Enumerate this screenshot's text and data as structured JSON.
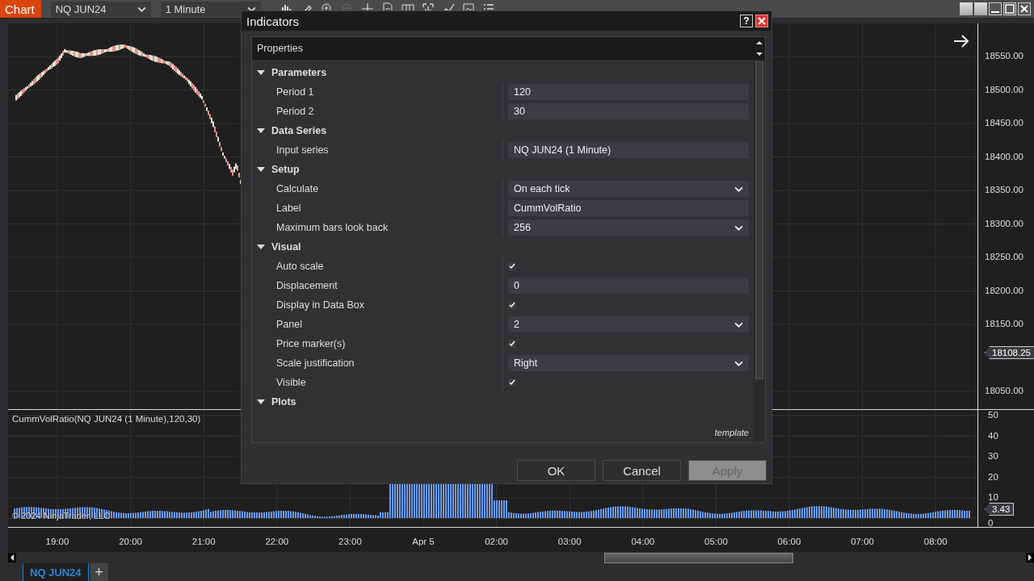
{
  "toolbar": {
    "app_label": "Chart",
    "instrument": "NQ JUN24",
    "interval": "1 Minute"
  },
  "chart": {
    "price_axis": [
      "18550.00",
      "18500.00",
      "18450.00",
      "18400.00",
      "18350.00",
      "18300.00",
      "18250.00",
      "18200.00",
      "18150.00",
      "18050.00"
    ],
    "last_price": "18108.25",
    "indicator_label": "CummVolRatio(NQ JUN24 (1 Minute),120,30)",
    "indicator_axis": [
      "50",
      "40",
      "30",
      "20",
      "10",
      "0"
    ],
    "indicator_value": "3.43",
    "copyright": "© 2024 NinjaTrader, LLC",
    "time_labels": [
      "19:00",
      "20:00",
      "21:00",
      "22:00",
      "23:00",
      "Apr 5",
      "02:00",
      "03:00",
      "04:00",
      "05:00",
      "06:00",
      "07:00",
      "08:00"
    ]
  },
  "dialog": {
    "title": "Indicators",
    "help": "?",
    "header": "Properties",
    "categories": [
      {
        "label": "Parameters",
        "expanded": true,
        "items": [
          {
            "label": "Period 1",
            "kind": "text",
            "value": "120"
          },
          {
            "label": "Period 2",
            "kind": "text",
            "value": "30"
          }
        ]
      },
      {
        "label": "Data Series",
        "expanded": true,
        "items": [
          {
            "label": "Input series",
            "kind": "text",
            "value": "NQ JUN24 (1 Minute)"
          }
        ]
      },
      {
        "label": "Setup",
        "expanded": true,
        "items": [
          {
            "label": "Calculate",
            "kind": "dropdown",
            "value": "On each tick"
          },
          {
            "label": "Label",
            "kind": "text",
            "value": "CummVolRatio"
          },
          {
            "label": "Maximum bars look back",
            "kind": "dropdown",
            "value": "256"
          }
        ]
      },
      {
        "label": "Visual",
        "expanded": true,
        "items": [
          {
            "label": "Auto scale",
            "kind": "checkbox",
            "checked": true
          },
          {
            "label": "Displacement",
            "kind": "text",
            "value": "0"
          },
          {
            "label": "Display in Data Box",
            "kind": "checkbox",
            "checked": true
          },
          {
            "label": "Panel",
            "kind": "dropdown",
            "value": "2"
          },
          {
            "label": "Price marker(s)",
            "kind": "checkbox",
            "checked": true
          },
          {
            "label": "Scale justification",
            "kind": "dropdown",
            "value": "Right"
          },
          {
            "label": "Visible",
            "kind": "checkbox",
            "checked": true
          }
        ]
      },
      {
        "label": "Plots",
        "expanded": true
      }
    ],
    "template_link": "template",
    "buttons": [
      {
        "label": "OK",
        "disabled": false
      },
      {
        "label": "Cancel",
        "disabled": false
      },
      {
        "label": "Apply",
        "disabled": true
      }
    ]
  },
  "tabs": [
    {
      "label": "NQ JUN24",
      "selected": true
    }
  ],
  "add_tab": "+"
}
